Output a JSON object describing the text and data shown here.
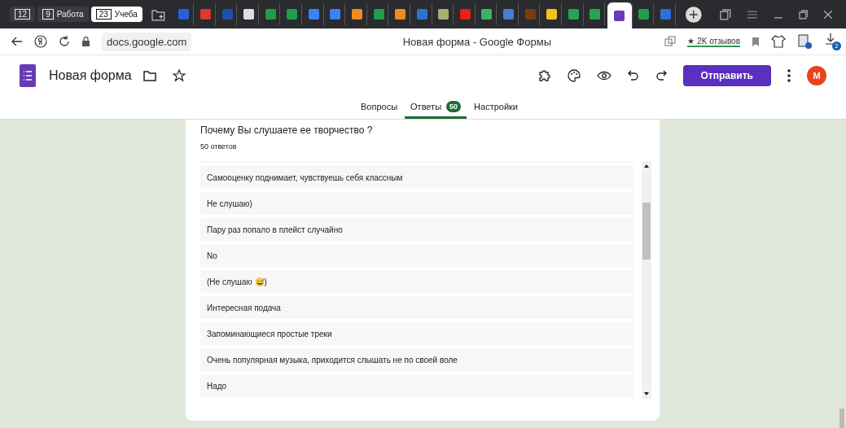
{
  "browser": {
    "groups": [
      {
        "count": "12",
        "selected": false
      },
      {
        "count": "9",
        "label": "Работа",
        "selected": false
      },
      {
        "count": "23",
        "label": "Учеба",
        "selected": true
      }
    ],
    "tabs": [
      {
        "color": "#2b5fd9",
        "selected": false
      },
      {
        "color": "#d93a2b",
        "selected": false
      },
      {
        "color": "#1f4fa8",
        "selected": false
      },
      {
        "color": "#dddddd",
        "selected": false
      },
      {
        "color": "#1e9e4a",
        "selected": false
      },
      {
        "color": "#1e9e4a",
        "selected": false
      },
      {
        "color": "#3b82f6",
        "selected": false
      },
      {
        "color": "#3b82f6",
        "selected": false
      },
      {
        "color": "#f08a24",
        "selected": false
      },
      {
        "color": "#1e9e4a",
        "selected": false
      },
      {
        "color": "#f08a24",
        "selected": false
      },
      {
        "color": "#2c73d2",
        "selected": false
      },
      {
        "color": "#a8b070",
        "selected": false
      },
      {
        "color": "#e62117",
        "selected": false
      },
      {
        "color": "#3bb36a",
        "selected": false
      },
      {
        "color": "#4a7bd0",
        "selected": false
      },
      {
        "color": "#7a3b10",
        "selected": false
      },
      {
        "color": "#f2c21b",
        "selected": false
      },
      {
        "color": "#23a455",
        "selected": false
      },
      {
        "color": "#23a455",
        "selected": false
      },
      {
        "color": "#673ab7",
        "selected": true
      },
      {
        "color": "#1e9e4a",
        "selected": false
      },
      {
        "color": "#2f6fd6",
        "selected": false
      }
    ],
    "url": "docs.google.com",
    "page_title": "Новая форма - Google Формы",
    "reviews": "★ 2K отзывов",
    "downloads": "2"
  },
  "form": {
    "title": "Новая форма",
    "send_button": "Отправить",
    "avatar": "M",
    "tabs": [
      {
        "label": "Вопросы",
        "selected": false
      },
      {
        "label": "Ответы",
        "selected": true,
        "badge": "50"
      },
      {
        "label": "Настройки",
        "selected": false
      }
    ]
  },
  "question": {
    "title": "Почему Вы слушаете ее творчество ?",
    "count": "50 ответов",
    "answers": [
      "Самооценку поднимает, чувствуешь себя классным",
      "Не слушаю)",
      "Пару раз попало в плейст случайно",
      "No",
      "(Не слушаю 😅)",
      "Интересная подача",
      "Запоминающиеся простые треки",
      "Очень популярная музыка, приходится слышать не по своей воле",
      "Надо"
    ]
  }
}
